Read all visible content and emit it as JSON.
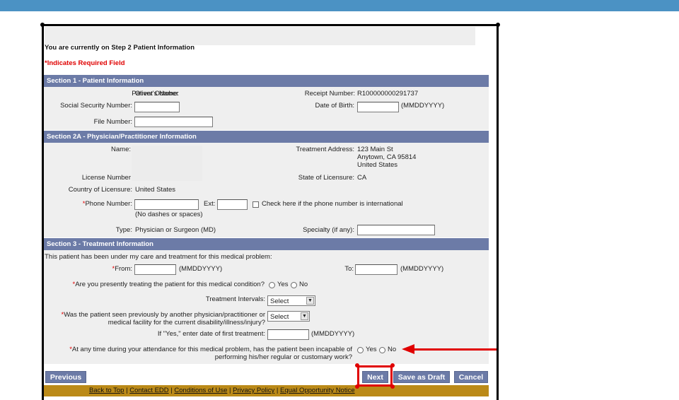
{
  "colors": {
    "topbar": "#4b92c4",
    "section_header": "#6c7ba7",
    "footer": "#bb8a18",
    "required": "#e00000",
    "annotation": "#e00000"
  },
  "page": {
    "step_text": "You are currently on Step 2 Patient Information",
    "required_asterisk": "*",
    "required_note": "Indicates Required Field"
  },
  "section1": {
    "title": "Section 1 - Patient Information",
    "patient_name_label": "Patient's Name:",
    "patient_name_value": "Oliver October",
    "receipt_label": "Receipt Number:",
    "receipt_value": "R100000000291737",
    "ssn_label": "Social Security Number:",
    "ssn_value": "",
    "dob_label": "Date of Birth:",
    "dob_value": "",
    "dob_format": "(MMDDYYYY)",
    "file_label": "File Number:",
    "file_value": ""
  },
  "section2a": {
    "title": "Section 2A - Physician/Practitioner Information",
    "name_label": "Name:",
    "address_label": "Treatment Address:",
    "address_line1": "123 Main St",
    "address_line2": "Anytown, CA 95814",
    "address_line3": "United States",
    "license_label": "License Number",
    "state_label": "State of Licensure:",
    "state_value": "CA",
    "country_label": "Country of Licensure:",
    "country_value": "United States",
    "phone_label": "Phone Number:",
    "phone_value": "",
    "ext_label": "Ext:",
    "ext_value": "",
    "intl_label": "Check here if the phone number is international",
    "phone_hint": "(No dashes or spaces)",
    "type_label": "Type:",
    "type_value": "Physician or Surgeon (MD)",
    "specialty_label": "Specialty (if any):",
    "specialty_value": ""
  },
  "section3": {
    "title": "Section 3 - Treatment Information",
    "intro": "This patient has been under my care and treatment for this medical problem:",
    "from_label": "From:",
    "from_value": "",
    "from_format": "(MMDDYYYY)",
    "to_label": "To:",
    "to_value": "",
    "to_format": "(MMDDYYYY)",
    "treating_q": "Are you presently treating the patient for this medical condition?",
    "yes": "Yes",
    "no": "No",
    "intervals_label": "Treatment Intervals:",
    "intervals_selected": "Select",
    "seen_q_line1": "Was the patient seen previously by another physician/practitioner or",
    "seen_q_line2": "medical facility for the current disability/illness/injury?",
    "seen_selected": "Select",
    "first_treatment_label": "If \"Yes,\" enter date of first treatment:",
    "first_treatment_value": "",
    "first_treatment_format": "(MMDDYYYY)",
    "incapable_q_line1": "At any time during your attendance for this medical problem, has the patient been incapable of",
    "incapable_q_line2": "performing his/her regular or customary work?"
  },
  "buttons": {
    "previous": "Previous",
    "next": "Next",
    "save_draft": "Save as Draft",
    "cancel": "Cancel"
  },
  "footer": {
    "links": [
      "Back to Top",
      "Contact EDD",
      "Conditions of Use",
      "Privacy Policy",
      "Equal Opportunity Notice"
    ],
    "separator": " | "
  }
}
